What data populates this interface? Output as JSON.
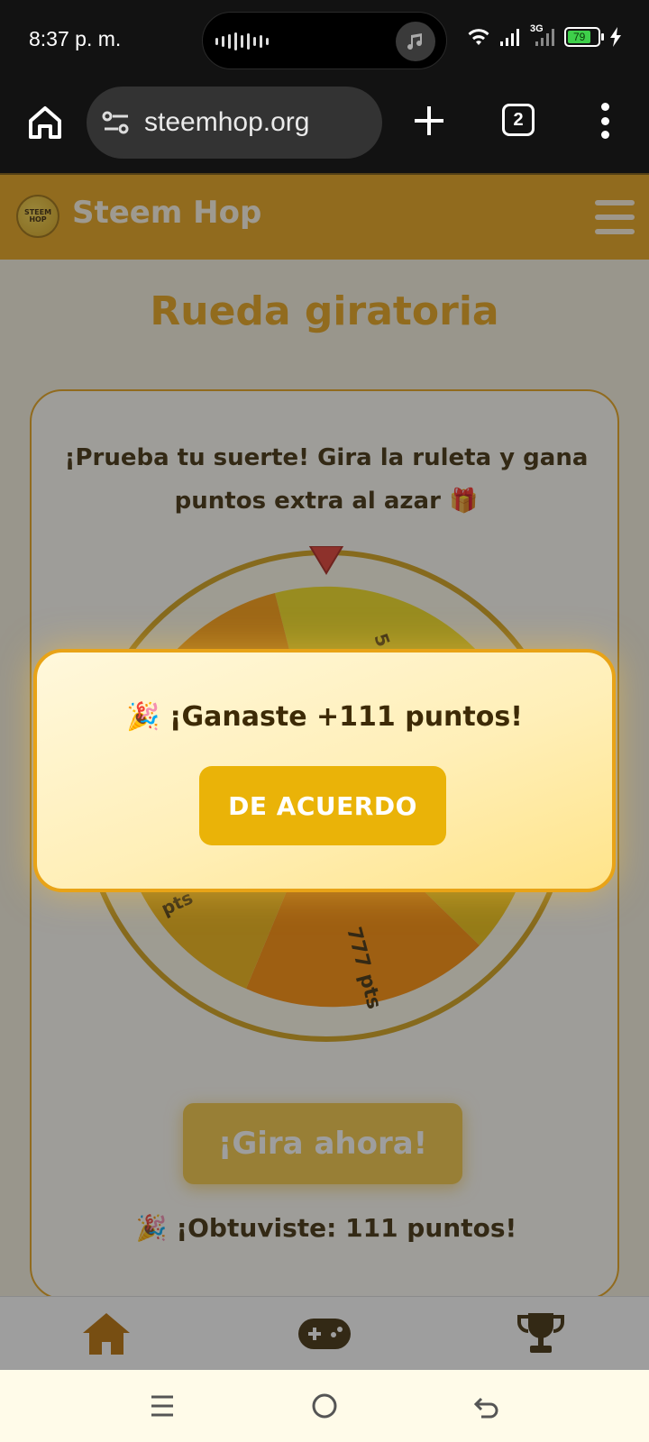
{
  "status_bar": {
    "time": "8:37 p. m.",
    "network": "3G",
    "battery": "79",
    "battery_level": 0.79
  },
  "browser": {
    "url": "steemhop.org",
    "tab_count": "2"
  },
  "header": {
    "logo_text": "STEEM HOP",
    "site_title": "Steem Hop"
  },
  "main": {
    "page_title": "Rueda giratoria",
    "intro": "¡Prueba tu suerte! Gira la ruleta y gana puntos extra al azar 🎁",
    "wheel_labels": [
      "5",
      "777 pts",
      "pts"
    ],
    "spin_button": "¡Gira ahora!",
    "result": "🎉 ¡Obtuviste: 111 puntos!"
  },
  "modal": {
    "message": "🎉 ¡Ganaste +111 puntos!",
    "confirm_button": "DE ACUERDO"
  },
  "bottom_nav": {
    "items": [
      {
        "icon": "home-icon",
        "active": true
      },
      {
        "icon": "gamepad-icon",
        "active": false
      },
      {
        "icon": "trophy-icon",
        "active": false
      }
    ]
  },
  "colors": {
    "brand": "#e8a317",
    "brand_dark": "#9b6100",
    "button": "#eab308"
  }
}
